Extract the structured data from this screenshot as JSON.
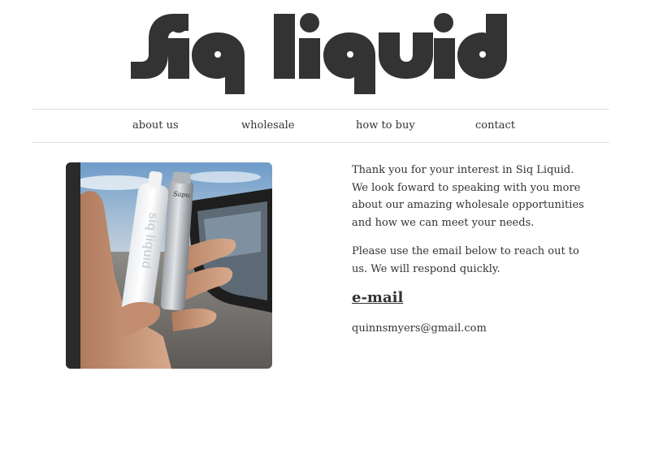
{
  "header": {
    "logo_text": "siq liquid"
  },
  "nav": {
    "items": [
      {
        "label": "about us"
      },
      {
        "label": "wholesale"
      },
      {
        "label": "how to buy"
      },
      {
        "label": "contact"
      }
    ]
  },
  "main": {
    "photo": {
      "bottle_brand_text": "siq liquid",
      "device_text": "Sapu"
    },
    "paragraph_1": "Thank you for your interest in Siq Liquid. We look foward to speaking with you more about our amazing wholesale opportunities and how we can meet your needs.",
    "paragraph_2": "Please use the email below to reach out to us. We will respond quickly.",
    "email_heading": "e-mail",
    "email_address": "quinnsmyers@gmail.com"
  },
  "colors": {
    "text": "#333333",
    "logo": "#333333",
    "rule": "#e2e2e2",
    "background": "#ffffff"
  }
}
